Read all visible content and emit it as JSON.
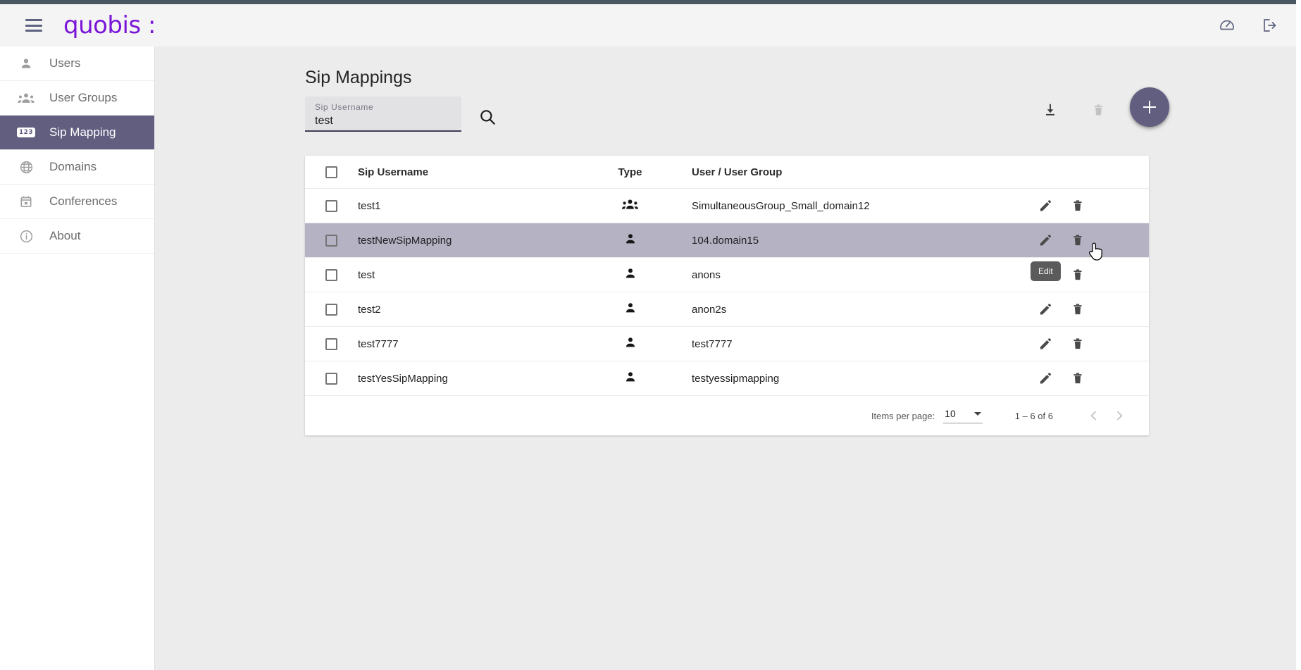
{
  "colors": {
    "brand": "#7b16d9",
    "accent": "#625e80",
    "row_highlight": "#b5b2c4",
    "page_bg": "#ececec",
    "field_bg": "#e2e2e4",
    "field_underline": "#3f3d56",
    "tooltip_bg": "#5b5b5b"
  },
  "header": {
    "brand": "quobis :",
    "menu_icon": "hamburger-icon",
    "icons": [
      {
        "name": "dashboard-speedometer-icon"
      },
      {
        "name": "logout-icon"
      }
    ]
  },
  "sidebar": {
    "items": [
      {
        "label": "Users",
        "icon": "person-icon",
        "active": false
      },
      {
        "label": "User Groups",
        "icon": "group-icon",
        "active": false
      },
      {
        "label": "Sip Mapping",
        "icon": "numbers-123-icon",
        "active": true
      },
      {
        "label": "Domains",
        "icon": "globe-icon",
        "active": false
      },
      {
        "label": "Conferences",
        "icon": "calendar-icon",
        "active": false
      },
      {
        "label": "About",
        "icon": "info-circle-icon",
        "active": false
      }
    ]
  },
  "main": {
    "page_title": "Sip Mappings",
    "search": {
      "label": "Sip Username",
      "value": "test",
      "placeholder": "Sip Username",
      "search_icon": "search-icon"
    },
    "toolbar": {
      "download_icon": "download-icon",
      "delete_icon": "trash-icon",
      "add_icon": "plus-icon"
    },
    "table": {
      "columns": [
        "Sip Username",
        "Type",
        "User / User Group"
      ],
      "select_all_checked": false,
      "rows": [
        {
          "sip_username": "test1",
          "type": "group-icon",
          "user": "SimultaneousGroup_Small_domain12",
          "checked": false,
          "highlighted": false
        },
        {
          "sip_username": "testNewSipMapping",
          "type": "person-icon",
          "user": "104.domain15",
          "checked": false,
          "highlighted": true
        },
        {
          "sip_username": "test",
          "type": "person-icon",
          "user": "anons",
          "checked": false,
          "highlighted": false
        },
        {
          "sip_username": "test2",
          "type": "person-icon",
          "user": "anon2s",
          "checked": false,
          "highlighted": false
        },
        {
          "sip_username": "test7777",
          "type": "person-icon",
          "user": "test7777",
          "checked": false,
          "highlighted": false
        },
        {
          "sip_username": "testYesSipMapping",
          "type": "person-icon",
          "user": "testyessipmapping",
          "checked": false,
          "highlighted": false
        }
      ],
      "row_actions": {
        "edit_label": "Edit",
        "edit_icon": "pencil-icon",
        "delete_icon": "trash-icon"
      },
      "tooltip": {
        "text": "Edit",
        "on_row_index": 2
      }
    },
    "pagination": {
      "items_per_page_label": "Items per page:",
      "items_per_page_value": "10",
      "range_label": "1 – 6 of 6",
      "prev_icon": "chevron-left-icon",
      "next_icon": "chevron-right-icon"
    }
  }
}
